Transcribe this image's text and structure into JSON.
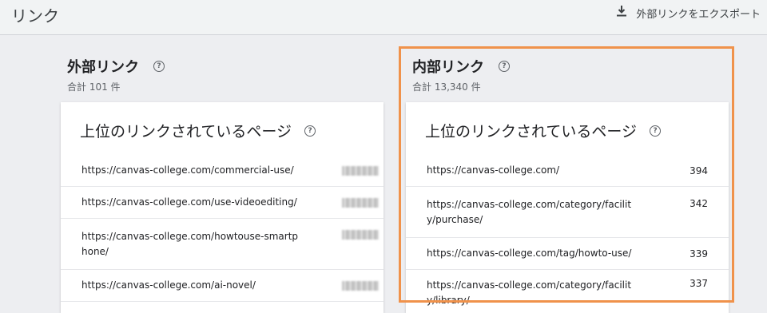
{
  "page": {
    "title": "リンク"
  },
  "toolbar": {
    "export_label": "外部リンクをエクスポート"
  },
  "external": {
    "title": "外部リンク",
    "total": "合計 101 件",
    "card_title": "上位のリンクされているページ",
    "rows": [
      {
        "url": "https://canvas-college.com/commercial-use/"
      },
      {
        "url": "https://canvas-college.com/use-videoediting/"
      },
      {
        "url": "https://canvas-college.com/howtouse-smartphone/"
      },
      {
        "url": "https://canvas-college.com/ai-novel/"
      }
    ]
  },
  "internal": {
    "title": "内部リンク",
    "total": "合計 13,340 件",
    "card_title": "上位のリンクされているページ",
    "rows": [
      {
        "url": "https://canvas-college.com/",
        "count": "394"
      },
      {
        "url": "https://canvas-college.com/category/facility/purchase/",
        "count": "342"
      },
      {
        "url": "https://canvas-college.com/tag/howto-use/",
        "count": "339"
      },
      {
        "url": "https://canvas-college.com/category/facility/library/",
        "count": "337"
      }
    ]
  },
  "colors": {
    "highlight": "#f0924b",
    "background": "#edeef1"
  }
}
